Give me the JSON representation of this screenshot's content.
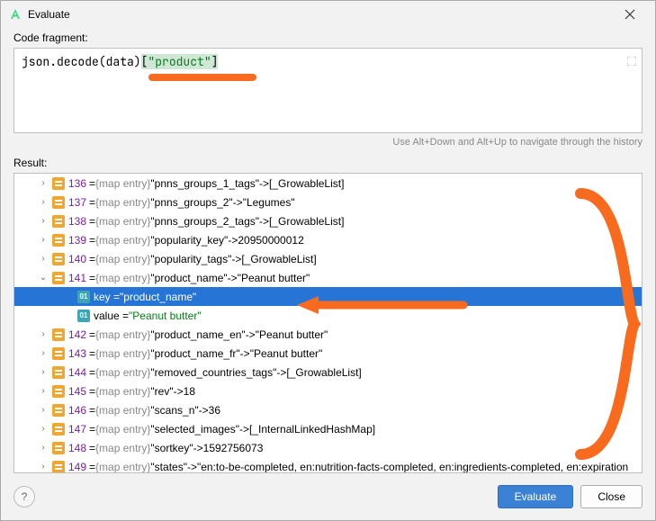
{
  "titlebar": {
    "title": "Evaluate"
  },
  "labels": {
    "code_fragment": "Code fragment:",
    "result": "Result:",
    "hint": "Use Alt+Down and Alt+Up to navigate through the history"
  },
  "code": {
    "prefix": "json.decode(data)",
    "open_bracket": "[",
    "string": "\"product\"",
    "close_bracket": "]"
  },
  "entries": [
    {
      "idx": "136",
      "key": "\"pnns_groups_1_tags\"",
      "val": "[_GrowableList]",
      "expanded": false
    },
    {
      "idx": "137",
      "key": "\"pnns_groups_2\"",
      "val": "\"Legumes\"",
      "expanded": false
    },
    {
      "idx": "138",
      "key": "\"pnns_groups_2_tags\"",
      "val": "[_GrowableList]",
      "expanded": false
    },
    {
      "idx": "139",
      "key": "\"popularity_key\"",
      "val": "20950000012",
      "expanded": false
    },
    {
      "idx": "140",
      "key": "\"popularity_tags\"",
      "val": "[_GrowableList]",
      "expanded": false
    },
    {
      "idx": "141",
      "key": "\"product_name\"",
      "val": "\"Peanut butter\"",
      "expanded": true
    },
    {
      "idx": "142",
      "key": "\"product_name_en\"",
      "val": "\"Peanut butter\"",
      "expanded": false
    },
    {
      "idx": "143",
      "key": "\"product_name_fr\"",
      "val": "\"Peanut butter\"",
      "expanded": false
    },
    {
      "idx": "144",
      "key": "\"removed_countries_tags\"",
      "val": "[_GrowableList]",
      "expanded": false
    },
    {
      "idx": "145",
      "key": "\"rev\"",
      "val": "18",
      "expanded": false
    },
    {
      "idx": "146",
      "key": "\"scans_n\"",
      "val": "36",
      "expanded": false
    },
    {
      "idx": "147",
      "key": "\"selected_images\"",
      "val": "[_InternalLinkedHashMap]",
      "expanded": false
    },
    {
      "idx": "148",
      "key": "\"sortkey\"",
      "val": "1592756073",
      "expanded": false
    },
    {
      "idx": "149",
      "key": "\"states\"",
      "val": "\"en:to-be-completed, en:nutrition-facts-completed, en:ingredients-completed, en:expiration",
      "expanded": false
    }
  ],
  "child": {
    "key_label": "key = ",
    "key_value": "\"product_name\"",
    "value_label": "value = ",
    "value_value": "\"Peanut butter\"",
    "badge": "01"
  },
  "type_label": "{map entry}",
  "eq_label": " = ",
  "arrow_label": " -> ",
  "buttons": {
    "evaluate": "Evaluate",
    "close": "Close",
    "help": "?"
  }
}
